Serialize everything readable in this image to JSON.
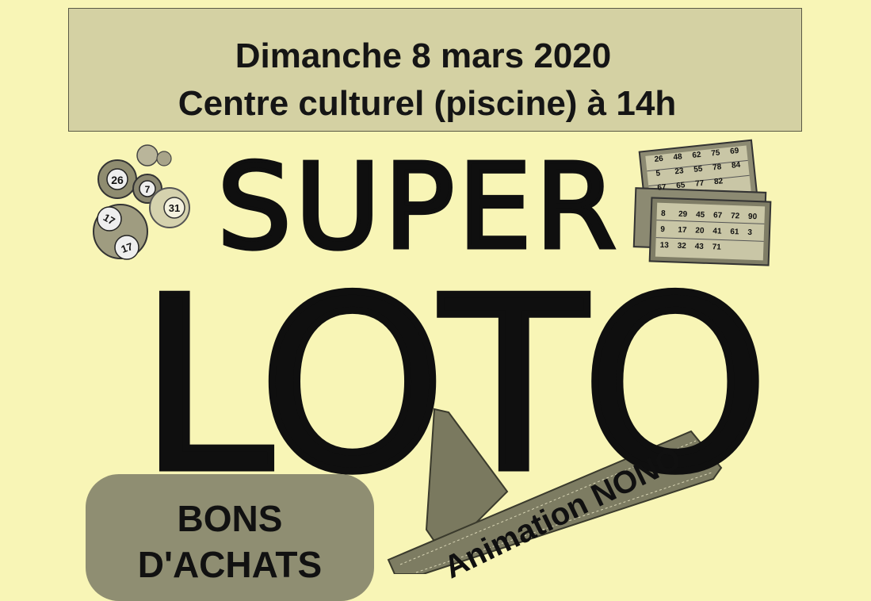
{
  "header": {
    "line1": "Dimanche 8 mars 2020",
    "line2": "Centre culturel (piscine) à 14h"
  },
  "title": {
    "super": "SUPER",
    "loto": "LOTO"
  },
  "balls": [
    "26",
    "7",
    "31",
    "17",
    "17"
  ],
  "cards": {
    "top_numbers": [
      "26",
      "48",
      "62",
      "75",
      "69",
      "5",
      "23",
      "55",
      "78",
      "84",
      "67",
      "65",
      "77",
      "82"
    ],
    "front_numbers": [
      "8",
      "29",
      "45",
      "67",
      "72",
      "90",
      "9",
      "17",
      "20",
      "41",
      "61",
      "3",
      "13",
      "32",
      "43",
      "71"
    ]
  },
  "bons": {
    "line1": "BONS",
    "line2": "D'ACHATS"
  },
  "ribbon": {
    "text": "Animation NONO"
  },
  "colors": {
    "background": "#f8f5b6",
    "header_box": "#d4d1a3",
    "bons_box": "#8f8e72",
    "ribbon": "#7d7c62",
    "text": "#111111"
  }
}
